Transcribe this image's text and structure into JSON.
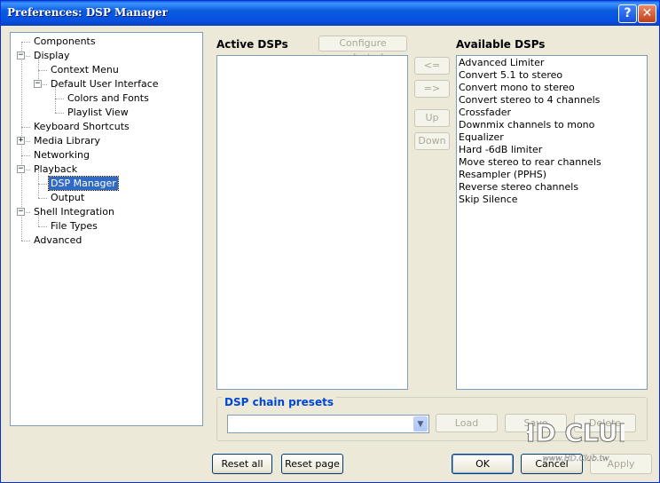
{
  "window": {
    "title": "Preferences: DSP Manager",
    "help_icon": "?",
    "close_icon": "✕"
  },
  "tree": [
    {
      "label": "Components"
    },
    {
      "label": "Display",
      "expander": "−"
    },
    {
      "label": "Context Menu"
    },
    {
      "label": "Default User Interface",
      "expander": "−"
    },
    {
      "label": "Colors and Fonts"
    },
    {
      "label": "Playlist View"
    },
    {
      "label": "Keyboard Shortcuts"
    },
    {
      "label": "Media Library",
      "expander": "+"
    },
    {
      "label": "Networking"
    },
    {
      "label": "Playback",
      "expander": "−"
    },
    {
      "label": "DSP Manager",
      "selected": true
    },
    {
      "label": "Output"
    },
    {
      "label": "Shell Integration",
      "expander": "−"
    },
    {
      "label": "File Types"
    },
    {
      "label": "Advanced"
    }
  ],
  "active_dsps": {
    "label": "Active DSPs",
    "configure_label": "Configure selected",
    "items": []
  },
  "move_buttons": {
    "add": "<=",
    "remove": "=>",
    "up": "Up",
    "down": "Down"
  },
  "available_dsps": {
    "label": "Available DSPs",
    "items": [
      "Advanced Limiter",
      "Convert 5.1 to stereo",
      "Convert mono to stereo",
      "Convert stereo to 4 channels",
      "Crossfader",
      "Downmix channels to mono",
      "Equalizer",
      "Hard -6dB limiter",
      "Move stereo to rear channels",
      "Resampler (PPHS)",
      "Reverse stereo channels",
      "Skip Silence"
    ]
  },
  "presets": {
    "title": "DSP chain presets",
    "combo_value": "",
    "combo_arrow": "▼",
    "load": "Load",
    "save": "Save",
    "delete": "Delete"
  },
  "footer": {
    "reset_all": "Reset all",
    "reset_page": "Reset page",
    "ok": "OK",
    "cancel": "Cancel",
    "apply": "Apply"
  },
  "watermark": {
    "text": "HD CLUB",
    "url": "www.HD.Club.tw"
  },
  "colors": {
    "selection": "#316ac5",
    "group_title": "#0046d5",
    "titlebar": "#0a5be0"
  }
}
